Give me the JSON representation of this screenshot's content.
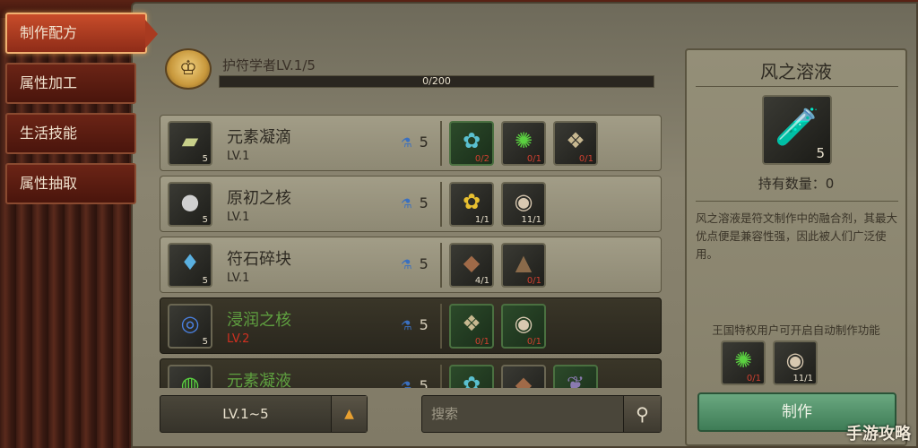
{
  "nav": {
    "items": [
      {
        "label": "制作配方",
        "active": true
      },
      {
        "label": "属性加工",
        "active": false
      },
      {
        "label": "生活技能",
        "active": false
      },
      {
        "label": "属性抽取",
        "active": false
      }
    ]
  },
  "header": {
    "badge_icon": "level-badge-icon",
    "profession": "护符学者LV.1/5",
    "progress_text": "0/200",
    "progress_fraction": 0.0
  },
  "recipes": [
    {
      "name": "元素凝滴",
      "level": "LV.1",
      "count": "5",
      "icon": "cloth-icon",
      "cost": "5",
      "dark": false,
      "materials": [
        {
          "icon": "blue-flower-icon",
          "count": "0/2",
          "short": true,
          "green": true
        },
        {
          "icon": "green-spiky-icon",
          "count": "0/1",
          "short": true,
          "green": false
        },
        {
          "icon": "striped-fish-icon",
          "count": "0/1",
          "short": true,
          "green": false
        }
      ]
    },
    {
      "name": "原初之核",
      "level": "LV.1",
      "count": "5",
      "icon": "pearl-icon",
      "cost": "5",
      "dark": false,
      "materials": [
        {
          "icon": "yellow-flower-icon",
          "count": "1/1",
          "short": false,
          "green": false
        },
        {
          "icon": "oyster-icon",
          "count": "11/1",
          "short": false,
          "green": false
        }
      ]
    },
    {
      "name": "符石碎块",
      "level": "LV.1",
      "count": "5",
      "icon": "crystal-icon",
      "cost": "5",
      "dark": false,
      "materials": [
        {
          "icon": "ore-chunk-icon",
          "count": "4/1",
          "short": false,
          "green": false
        },
        {
          "icon": "rubble-icon",
          "count": "0/1",
          "short": true,
          "green": false
        }
      ]
    },
    {
      "name": "浸润之核",
      "level": "LV.2",
      "count": "5",
      "icon": "blue-orb-icon",
      "cost": "5",
      "dark": true,
      "materials": [
        {
          "icon": "striped-fish-icon",
          "count": "0/1",
          "short": true,
          "green": true
        },
        {
          "icon": "oyster-icon",
          "count": "0/1",
          "short": true,
          "green": true
        }
      ]
    },
    {
      "name": "元素凝液",
      "level": "",
      "count": "",
      "icon": "green-potion-icon",
      "cost": "5",
      "dark": true,
      "materials": [
        {
          "icon": "blue-flower-icon",
          "count": "",
          "short": false,
          "green": true
        },
        {
          "icon": "ore-chunk-icon",
          "count": "",
          "short": false,
          "green": false
        },
        {
          "icon": "feather-icon",
          "count": "",
          "short": false,
          "green": true
        }
      ]
    }
  ],
  "filter": {
    "level_range": "LV.1~5",
    "search_placeholder": "搜索"
  },
  "detail": {
    "title": "风之溶液",
    "icon": "green-potion-icon",
    "count": "5",
    "held": "持有数量：0",
    "description": "风之溶液是符文制作中的融合剂，其最大优点便是兼容性强，因此被人们广泛使用。",
    "vip_note": "王国特权用户可开启自动制作功能",
    "materials": [
      {
        "icon": "green-spiky-icon",
        "count": "0/1",
        "short": true
      },
      {
        "icon": "oyster-icon",
        "count": "11/1",
        "short": false
      }
    ],
    "craft_label": "制作"
  },
  "watermark": "手游攻略"
}
